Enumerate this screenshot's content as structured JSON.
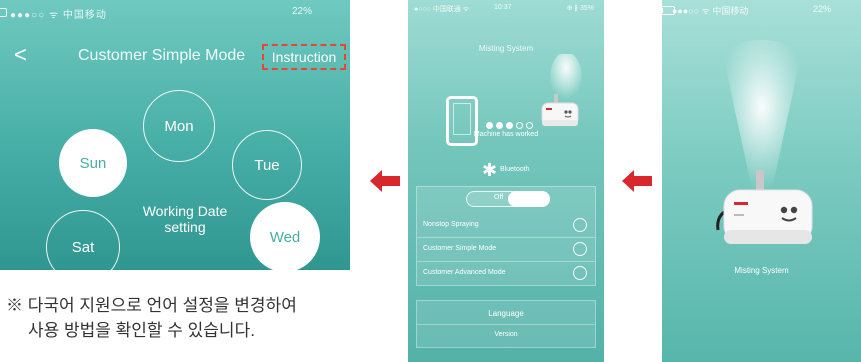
{
  "screen1": {
    "status": {
      "carrier": "●●●○○ ᯤ 中国移动",
      "battery": "22%"
    },
    "back": "<",
    "title": "Customer Simple Mode",
    "instruction": "Instruction",
    "days": {
      "mon": "Mon",
      "sun": "Sun",
      "tue": "Tue",
      "sat": "Sat",
      "wed": "Wed"
    },
    "center_line1": "Working Date",
    "center_line2": "setting"
  },
  "note": {
    "line1": "※ 다국어 지원으로 언어 설정을 변경하여",
    "line2": "사용 방법을 확인할 수 있습니다."
  },
  "screen2": {
    "status": {
      "carrier": "●○○○ 中国联通 ᯤ",
      "time": "10:37",
      "battery": "⊕ ∦ 35%"
    },
    "title": "Misting System",
    "machine_status": "Machine has worked",
    "bluetooth_label": "Bluetooth",
    "toggle_label": "Off",
    "options": [
      {
        "label": "Nonstop Spraying"
      },
      {
        "label": "Customer Simple Mode"
      },
      {
        "label": "Customer Advanced Mode"
      }
    ],
    "language": "Language",
    "version": "Version"
  },
  "screen3": {
    "status": {
      "carrier": "●●●○○ ᯤ 中国移动",
      "battery": "22%"
    },
    "label": "Misting System"
  },
  "colors": {
    "teal": "#46aea6",
    "accent_red": "#d9272e",
    "instruction_border": "#e8472f"
  }
}
